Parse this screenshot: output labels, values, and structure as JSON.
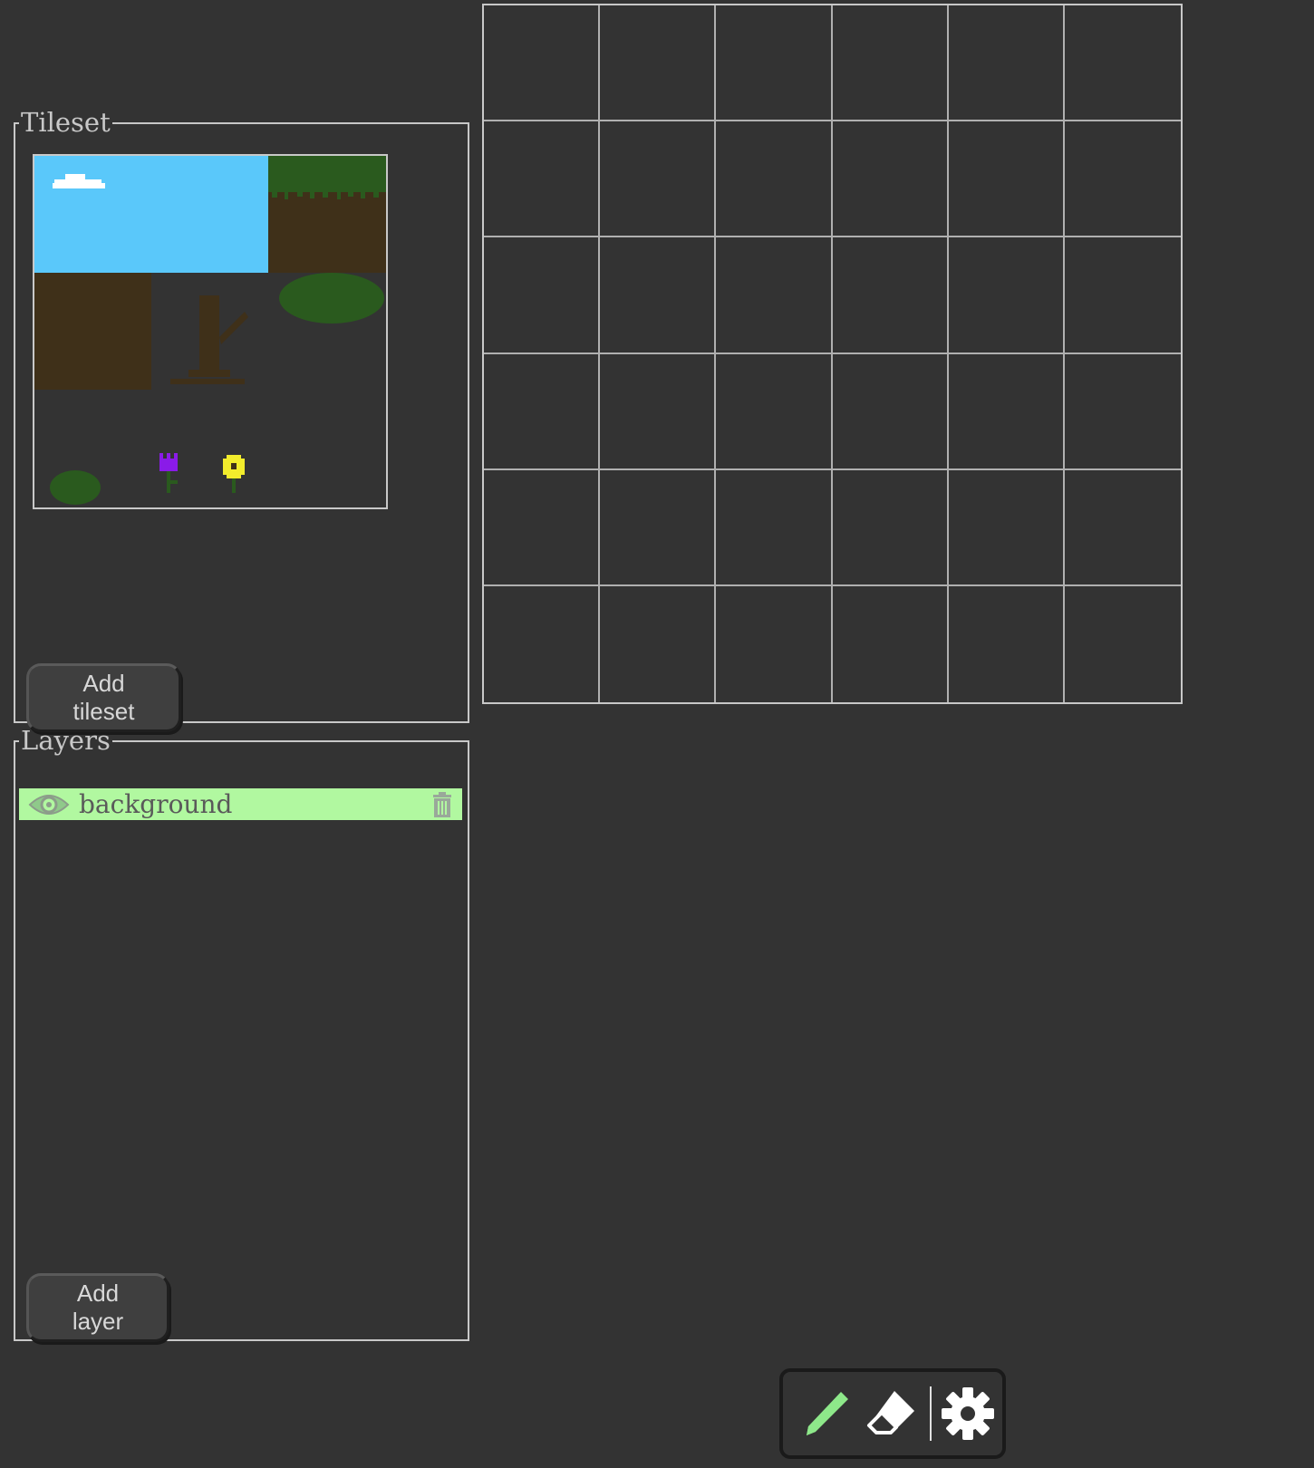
{
  "tileset_panel": {
    "legend": "Tileset",
    "add_button_label": "Add tileset"
  },
  "layers_panel": {
    "legend": "Layers",
    "layers": [
      {
        "name": "background",
        "visible": true,
        "selected": true
      }
    ],
    "add_button_label": "Add layer"
  },
  "map_grid": {
    "columns": 6,
    "rows": 6
  },
  "toolbar": {
    "tools": [
      {
        "name": "pencil-icon",
        "active": true
      },
      {
        "name": "eraser-icon",
        "active": false
      },
      {
        "name": "gear-icon",
        "active": false
      }
    ]
  },
  "colors": {
    "background": "#333333",
    "border": "#c8c8c8",
    "selected_layer": "#b1f8a0",
    "active_tool": "#8ee88a",
    "sky": "#5ac8fa",
    "dirt": "#3f3019",
    "grass": "#2a5a1e"
  }
}
